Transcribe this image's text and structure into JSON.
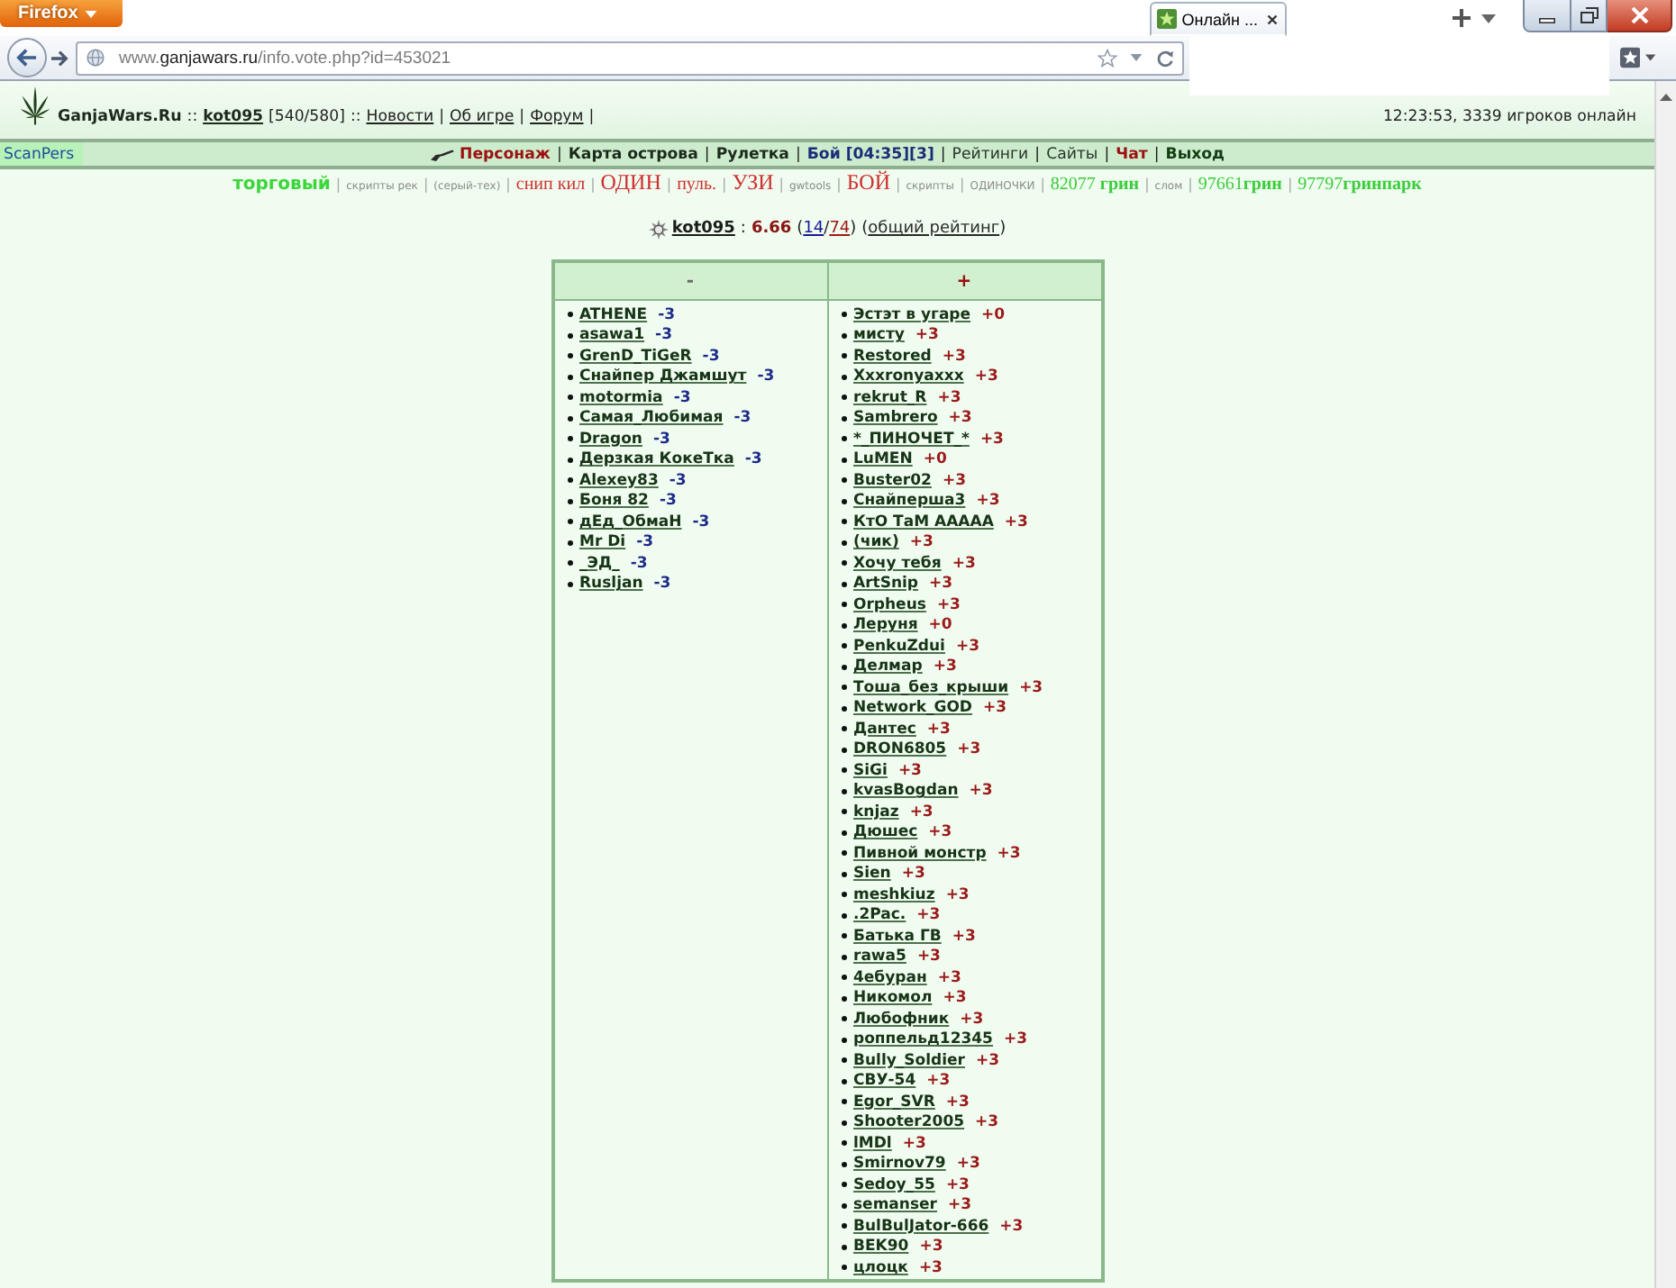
{
  "browser": {
    "menu_button": "Firefox",
    "tabs": [
      {
        "title": "Онлайн ...",
        "selected": true
      }
    ],
    "address": {
      "prefix": "www.",
      "domain": "ganjawars.ru",
      "path": "/info.vote.php?id=453021"
    }
  },
  "header": {
    "segments": [
      {
        "text": "GanjaWars.Ru",
        "kind": "brand"
      },
      {
        "text": "::",
        "kind": "separator"
      },
      {
        "text": "kot095",
        "kind": "user"
      },
      {
        "text": "[540/580]",
        "kind": "text"
      },
      {
        "text": "::",
        "kind": "separator"
      },
      {
        "text": "Новости",
        "kind": "link"
      },
      {
        "text": "|",
        "kind": "separator"
      },
      {
        "text": "Об игре",
        "kind": "link"
      },
      {
        "text": "|",
        "kind": "separator"
      },
      {
        "text": "Форум",
        "kind": "link"
      },
      {
        "text": "|",
        "kind": "separator"
      }
    ],
    "status": "12:23:53, 3339 игроков онлайн"
  },
  "nav": {
    "scan_button": "ScanPers",
    "items": [
      {
        "label": "Персонаж",
        "kind": "strong",
        "color": "#9b1010"
      },
      {
        "label": "|",
        "kind": "separator"
      },
      {
        "label": "Карта острова",
        "kind": "strong",
        "color": "#1c2a1c"
      },
      {
        "label": "|",
        "kind": "separator"
      },
      {
        "label": "Рулетка",
        "kind": "strong",
        "color": "#1c2a1c"
      },
      {
        "label": "|",
        "kind": "separator"
      },
      {
        "label": "Бой [04:35][3]",
        "kind": "strong",
        "color": "#1a2d78"
      },
      {
        "label": "|",
        "kind": "separator"
      },
      {
        "label": "Рейтинги",
        "kind": "regular",
        "color": "#2a332a"
      },
      {
        "label": "|",
        "kind": "separator"
      },
      {
        "label": "Сайты",
        "kind": "regular",
        "color": "#2a332a"
      },
      {
        "label": "|",
        "kind": "separator"
      },
      {
        "label": "Чат",
        "kind": "strong",
        "color": "#9b1010"
      },
      {
        "label": "|",
        "kind": "separator"
      },
      {
        "label": "Выход",
        "kind": "strong",
        "color": "#123d12"
      }
    ]
  },
  "tools": {
    "items": [
      {
        "text": "**торговый**",
        "kind": "feature",
        "color": "#3cd63c"
      },
      {
        "text": "|",
        "kind": "separator"
      },
      {
        "text": "скрипты рек",
        "kind": "minor"
      },
      {
        "text": "|",
        "kind": "separator"
      },
      {
        "text": "(серый-тех)",
        "kind": "minor"
      },
      {
        "text": "|",
        "kind": "separator"
      },
      {
        "text": "снип кил",
        "kind": "serif",
        "color": "#d03030"
      },
      {
        "text": "|",
        "kind": "separator"
      },
      {
        "text": "ОДИН",
        "kind": "serif-large",
        "color": "#d03030"
      },
      {
        "text": "|",
        "kind": "separator"
      },
      {
        "text": "пуль.",
        "kind": "serif",
        "color": "#d03030"
      },
      {
        "text": "|",
        "kind": "separator"
      },
      {
        "text": "УЗИ",
        "kind": "serif-large",
        "color": "#d03030"
      },
      {
        "text": "|",
        "kind": "separator"
      },
      {
        "text": "gwtools",
        "kind": "minor"
      },
      {
        "text": "|",
        "kind": "separator"
      },
      {
        "text": "БОЙ",
        "kind": "serif-large",
        "color": "#d03030"
      },
      {
        "text": "|",
        "kind": "separator"
      },
      {
        "text": "скрипты",
        "kind": "minor"
      },
      {
        "text": "|",
        "kind": "separator"
      },
      {
        "text": "ОДИНОЧКИ",
        "kind": "minor"
      },
      {
        "text": "|",
        "kind": "separator"
      },
      {
        "text": "82077 **грин**",
        "kind": "serif",
        "color": "#3ccc3c"
      },
      {
        "text": "|",
        "kind": "separator"
      },
      {
        "text": "слом",
        "kind": "minor"
      },
      {
        "text": "|",
        "kind": "separator"
      },
      {
        "text": "97661**грин**",
        "kind": "serif",
        "color": "#3ccc3c"
      },
      {
        "text": "|",
        "kind": "separator"
      },
      {
        "text": "97797**гринпарк**",
        "kind": "serif",
        "color": "#3ccc3c"
      }
    ]
  },
  "rating": {
    "segments": [
      {
        "text": "kot095",
        "kind": "user"
      },
      {
        "text": ":",
        "kind": "colon"
      },
      {
        "text": "6.66",
        "kind": "score"
      },
      {
        "text": "(",
        "kind": "open"
      },
      {
        "text": "14",
        "kind": "link",
        "color": "#1a1a99"
      },
      {
        "text": "/",
        "kind": "slash"
      },
      {
        "text": "74",
        "kind": "link",
        "color": "#a01a1a"
      },
      {
        "text": ")",
        "kind": "close"
      },
      {
        "text": "(",
        "kind": "open"
      },
      {
        "text": "общий рейтинг",
        "kind": "link",
        "color": "#2a2a2a"
      },
      {
        "text": ")",
        "kind": "close"
      }
    ]
  },
  "vote_table": {
    "columns": [
      {
        "heading": "-",
        "kind": "minus",
        "voters": [
          {
            "name": "ATHENE",
            "vote": "-3"
          },
          {
            "name": "asawa1",
            "vote": "-3"
          },
          {
            "name": "GrenD_TiGeR",
            "vote": "-3"
          },
          {
            "name": "Снайпер Джамшут",
            "vote": "-3"
          },
          {
            "name": "motormia",
            "vote": "-3"
          },
          {
            "name": "Самая_Любимая",
            "vote": "-3"
          },
          {
            "name": "Dragon",
            "vote": "-3"
          },
          {
            "name": "Дерзкая КокеТка",
            "vote": "-3"
          },
          {
            "name": "Alexey83",
            "vote": "-3"
          },
          {
            "name": "Боня 82",
            "vote": "-3"
          },
          {
            "name": "дЕд_ОбмаН",
            "vote": "-3"
          },
          {
            "name": "Mr Di",
            "vote": "-3"
          },
          {
            "name": "_ЭД_",
            "vote": "-3"
          },
          {
            "name": "Rusljan",
            "vote": "-3"
          }
        ]
      },
      {
        "heading": "+",
        "kind": "plus",
        "voters": [
          {
            "name": "Эстэт в угаре",
            "vote": "+0"
          },
          {
            "name": "мисту",
            "vote": "+3"
          },
          {
            "name": "Restored",
            "vote": "+3"
          },
          {
            "name": "Xxxronyaxxx",
            "vote": "+3"
          },
          {
            "name": "rekrut_R",
            "vote": "+3"
          },
          {
            "name": "Sambrero",
            "vote": "+3"
          },
          {
            "name": "*_ПИНОЧЕТ_*",
            "vote": "+3"
          },
          {
            "name": "LuMEN",
            "vote": "+0"
          },
          {
            "name": "Buster02",
            "vote": "+3"
          },
          {
            "name": "Снайперша3",
            "vote": "+3"
          },
          {
            "name": "КтО ТаМ ААААА",
            "vote": "+3"
          },
          {
            "name": "(чик)",
            "vote": "+3"
          },
          {
            "name": "Хочу тебя",
            "vote": "+3"
          },
          {
            "name": "ArtSnip",
            "vote": "+3"
          },
          {
            "name": "Orpheus",
            "vote": "+3"
          },
          {
            "name": "Леруня",
            "vote": "+0"
          },
          {
            "name": "PenkuZdui",
            "vote": "+3"
          },
          {
            "name": "Делмар",
            "vote": "+3"
          },
          {
            "name": "Тоша_без_крыши",
            "vote": "+3"
          },
          {
            "name": "Network_GOD",
            "vote": "+3"
          },
          {
            "name": "Дантес",
            "vote": "+3"
          },
          {
            "name": "DRON6805",
            "vote": "+3"
          },
          {
            "name": "SiGi",
            "vote": "+3"
          },
          {
            "name": "kvasBogdan",
            "vote": "+3"
          },
          {
            "name": "knjaz",
            "vote": "+3"
          },
          {
            "name": "Дюшес",
            "vote": "+3"
          },
          {
            "name": "Пивной монстр",
            "vote": "+3"
          },
          {
            "name": "Sien",
            "vote": "+3"
          },
          {
            "name": "meshkiuz",
            "vote": "+3"
          },
          {
            "name": ".2Pac.",
            "vote": "+3"
          },
          {
            "name": "Батька ГВ",
            "vote": "+3"
          },
          {
            "name": "rawa5",
            "vote": "+3"
          },
          {
            "name": "4ебуран",
            "vote": "+3"
          },
          {
            "name": "Никомол",
            "vote": "+3"
          },
          {
            "name": "Любофник",
            "vote": "+3"
          },
          {
            "name": "роппельд12345",
            "vote": "+3"
          },
          {
            "name": "Bully_Soldier",
            "vote": "+3"
          },
          {
            "name": "СВУ-54",
            "vote": "+3"
          },
          {
            "name": "Egor_SVR",
            "vote": "+3"
          },
          {
            "name": "Shooter2005",
            "vote": "+3"
          },
          {
            "name": "lMDl",
            "vote": "+3"
          },
          {
            "name": "Smirnov79",
            "vote": "+3"
          },
          {
            "name": "Sedoy_55",
            "vote": "+3"
          },
          {
            "name": "semanser",
            "vote": "+3"
          },
          {
            "name": "BulBulJator-666",
            "vote": "+3"
          },
          {
            "name": "BEK90",
            "vote": "+3"
          },
          {
            "name": "цлоцк",
            "vote": "+3"
          }
        ]
      }
    ]
  }
}
